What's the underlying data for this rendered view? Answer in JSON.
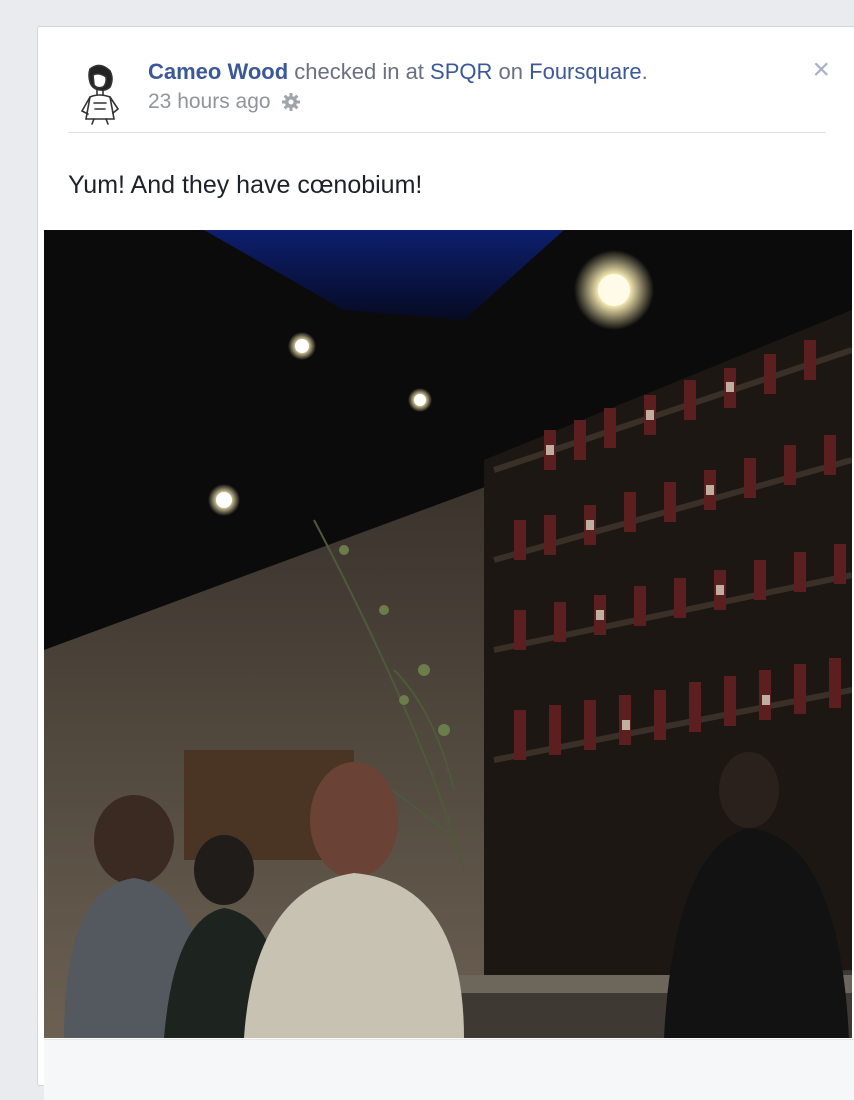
{
  "post": {
    "author": "Cameo Wood",
    "action_text": "checked in at",
    "place": "SPQR",
    "on_text": "on",
    "service": "Foursquare",
    "period": ".",
    "timestamp": "23 hours ago",
    "message": "Yum! And they have cœnobium!",
    "close_symbol": "×"
  },
  "icons": {
    "privacy": "gear-icon",
    "close": "close-icon"
  },
  "colors": {
    "link": "#3b5998",
    "meta": "#90949c",
    "page_bg": "#e9ebee"
  }
}
